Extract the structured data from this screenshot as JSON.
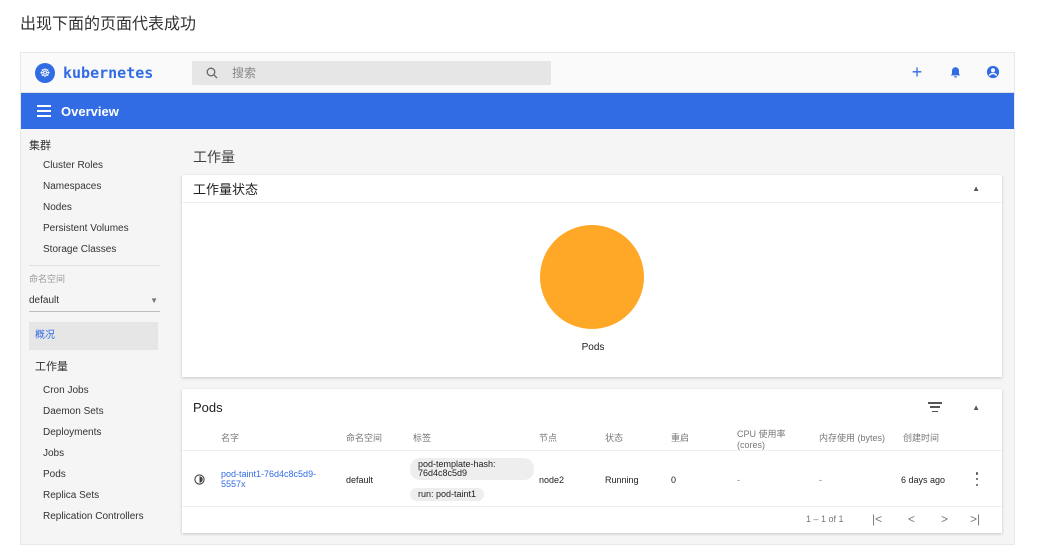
{
  "caption": "出现下面的页面代表成功",
  "app": {
    "logo_text": "kubernetes",
    "search_placeholder": "搜索",
    "header_title": "Overview",
    "colors": {
      "primary": "#326ce5",
      "pie": "#ffa726"
    }
  },
  "sidebar": {
    "cluster_heading": "集群",
    "cluster_items": [
      "Cluster Roles",
      "Namespaces",
      "Nodes",
      "Persistent Volumes",
      "Storage Classes"
    ],
    "namespace_label": "命名空间",
    "namespace_value": "default",
    "overview_label": "概况",
    "workloads_heading": "工作量",
    "workload_items": [
      "Cron Jobs",
      "Daemon Sets",
      "Deployments",
      "Jobs",
      "Pods",
      "Replica Sets",
      "Replication Controllers"
    ]
  },
  "main": {
    "page_title": "工作量",
    "status_card_title": "工作量状态",
    "pie_label": "Pods",
    "pods_card_title": "Pods",
    "columns": [
      "名字",
      "命名空间",
      "标签",
      "节点",
      "状态",
      "重启",
      "CPU 使用率 (cores)",
      "内存使用 (bytes)",
      "创建时间"
    ],
    "rows": [
      {
        "name": "pod-taint1-76d4c8c5d9-5557x",
        "namespace": "default",
        "labels": [
          "pod-template-hash: 76d4c8c5d9",
          "run: pod-taint1"
        ],
        "node": "node2",
        "status": "Running",
        "restarts": "0",
        "cpu": "-",
        "memory": "-",
        "created": "6 days ago"
      }
    ],
    "pagination": "1 – 1 of 1"
  }
}
